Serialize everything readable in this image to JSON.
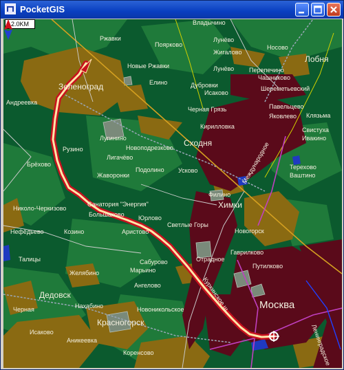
{
  "window": {
    "title": "PocketGIS"
  },
  "map": {
    "scale_label": "2.0KM",
    "colors": {
      "forest_dark": "#0b5a2e",
      "forest": "#1f7a3a",
      "field": "#8a6a12",
      "urban": "#5a0a1a",
      "road": "#d9d9d9",
      "route_outer": "#c8111e",
      "route_inner": "#ffe6a8",
      "water": "#1f3ac0"
    },
    "labels": [
      {
        "id": "ryazhki",
        "text": "Ржавки"
      },
      {
        "id": "vladychino",
        "text": "Владычино"
      },
      {
        "id": "poyarkovo",
        "text": "Поярково"
      },
      {
        "id": "lunevo1",
        "text": "Лунёво"
      },
      {
        "id": "nosovo",
        "text": "Носово"
      },
      {
        "id": "zhigalovo",
        "text": "Жигалово"
      },
      {
        "id": "lobnya",
        "text": "Лобня"
      },
      {
        "id": "novye-ryazhki",
        "text": "Новые Ржавки"
      },
      {
        "id": "lunevo2",
        "text": "Лунёво"
      },
      {
        "id": "perepechino",
        "text": "Перепечино"
      },
      {
        "id": "chashnikovo",
        "text": "Чашниково"
      },
      {
        "id": "zelenograd",
        "text": "Зеленоград"
      },
      {
        "id": "elino",
        "text": "Елино"
      },
      {
        "id": "dubrovki",
        "text": "Дубровки"
      },
      {
        "id": "isakovo1",
        "text": "Исаково"
      },
      {
        "id": "sheremetyevsky",
        "text": "Шереметьевский"
      },
      {
        "id": "andreevka",
        "text": "Андреевка"
      },
      {
        "id": "chernaya-gryaz",
        "text": "Черная Грязь"
      },
      {
        "id": "pavelcevo",
        "text": "Павельцево"
      },
      {
        "id": "yakovlevo",
        "text": "Яковлево"
      },
      {
        "id": "klyazma",
        "text": "Клязьма"
      },
      {
        "id": "kirillovka",
        "text": "Кирилловка"
      },
      {
        "id": "svistuha",
        "text": "Свистуха"
      },
      {
        "id": "lugino",
        "text": "Лугинино"
      },
      {
        "id": "ivakino",
        "text": "Ивакино"
      },
      {
        "id": "novopodrezkovo",
        "text": "Новоподрезково"
      },
      {
        "id": "shodnya",
        "text": "Сходня"
      },
      {
        "id": "ruzino",
        "text": "Рузино"
      },
      {
        "id": "mezhdunarodnoe",
        "text": "Международное"
      },
      {
        "id": "ligachevo",
        "text": "Лигачёво"
      },
      {
        "id": "terehovo",
        "text": "Терехово"
      },
      {
        "id": "vashutino",
        "text": "Ваштино"
      },
      {
        "id": "brekhovo",
        "text": "Брёхово"
      },
      {
        "id": "podolino",
        "text": "Подолино"
      },
      {
        "id": "uskovo",
        "text": "Усково"
      },
      {
        "id": "zhavoronki",
        "text": "Жаворонки"
      },
      {
        "id": "fedino",
        "text": "Филино"
      },
      {
        "id": "khimki",
        "text": "Химки"
      },
      {
        "id": "nikolo-cherkizovo",
        "text": "Николо-Черкизово"
      },
      {
        "id": "energia",
        "text": "Санатория \"Энергия\""
      },
      {
        "id": "nefedevo",
        "text": "Нефёдьево"
      },
      {
        "id": "bolshakovo",
        "text": "Большаково"
      },
      {
        "id": "yurlovo",
        "text": "Юрлово"
      },
      {
        "id": "novogorsk",
        "text": "Новогорск"
      },
      {
        "id": "kozino",
        "text": "Козино"
      },
      {
        "id": "aristovo",
        "text": "Аристово"
      },
      {
        "id": "svetlye-gory",
        "text": "Светлые Горы"
      },
      {
        "id": "talicy",
        "text": "Талицы"
      },
      {
        "id": "gavrilkovo",
        "text": "Гаврилково"
      },
      {
        "id": "otradnoe",
        "text": "Отрадное"
      },
      {
        "id": "saburovo",
        "text": "Сабурово"
      },
      {
        "id": "putilkovo",
        "text": "Путилково"
      },
      {
        "id": "zhelyabino",
        "text": "Желябино"
      },
      {
        "id": "marino",
        "text": "Марьино"
      },
      {
        "id": "angelovo",
        "text": "Ангелово"
      },
      {
        "id": "dedovsk",
        "text": "Дедовск"
      },
      {
        "id": "moskva",
        "text": "Москва"
      },
      {
        "id": "nakhabino",
        "text": "Нахабино"
      },
      {
        "id": "novonikolskoe",
        "text": "Новоникольское"
      },
      {
        "id": "chernaya",
        "text": "Черная"
      },
      {
        "id": "krasnogorsk",
        "text": "Красногорск"
      },
      {
        "id": "isakovo2",
        "text": "Исаково"
      },
      {
        "id": "anikeevka",
        "text": "Аникеевка"
      },
      {
        "id": "koptevo",
        "text": "Коренсово"
      },
      {
        "id": "leningradskoe",
        "text": "Ленинградское"
      },
      {
        "id": "kurortny",
        "text": "Куркинское ш."
      }
    ]
  }
}
